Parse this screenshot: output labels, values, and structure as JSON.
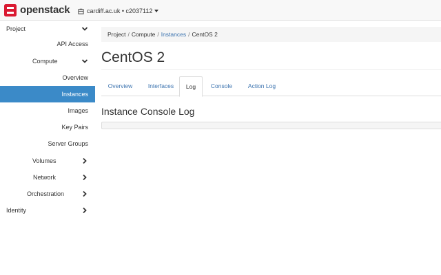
{
  "brand": {
    "name": "openstack",
    "logo_icon": "openstack-logo-icon",
    "accent": "#da1a32"
  },
  "project_switcher": {
    "label": "cardiff.ac.uk • c2037112",
    "icon": "project-cube-icon"
  },
  "sidebar": {
    "active_color": "#3b8ac8",
    "items": [
      {
        "label": "Project",
        "icon": "chevron-down-icon"
      },
      {
        "label": "API Access"
      },
      {
        "label": "Compute",
        "icon": "chevron-down-icon"
      },
      {
        "label": "Overview"
      },
      {
        "label": "Instances",
        "active": true
      },
      {
        "label": "Images"
      },
      {
        "label": "Key Pairs"
      },
      {
        "label": "Server Groups"
      },
      {
        "label": "Volumes",
        "icon": "chevron-right-icon"
      },
      {
        "label": "Network",
        "icon": "chevron-right-icon"
      },
      {
        "label": "Orchestration",
        "icon": "chevron-right-icon"
      },
      {
        "label": "Identity",
        "icon": "chevron-right-icon"
      }
    ]
  },
  "breadcrumb": {
    "items": [
      "Project",
      "Compute",
      "Instances",
      "CentOS 2"
    ],
    "separator": "/"
  },
  "page": {
    "title": "CentOS 2"
  },
  "tabs": [
    {
      "label": "Overview"
    },
    {
      "label": "Interfaces"
    },
    {
      "label": "Log",
      "active": true
    },
    {
      "label": "Console"
    },
    {
      "label": "Action Log"
    }
  ],
  "log_section": {
    "title": "Instance Console Log",
    "content": ""
  }
}
